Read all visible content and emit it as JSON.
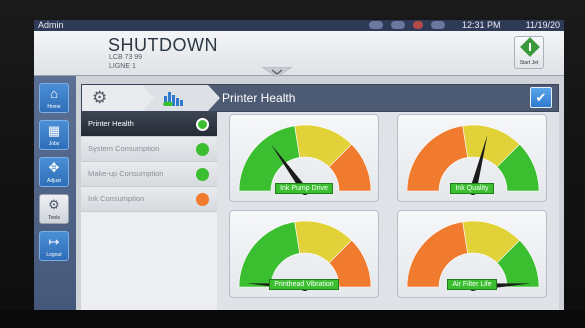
{
  "status_bar": {
    "user": "Admin",
    "time": "12:31 PM",
    "date": "11/19/20"
  },
  "header": {
    "state": "SHUTDOWN",
    "line1": "LCB 73 99",
    "line2": "LIGNE 1",
    "start_jet_label": "Start Jet"
  },
  "sidebar": {
    "items": [
      {
        "label": "Home",
        "icon": "home-icon"
      },
      {
        "label": "Jobs",
        "icon": "jobs-icon"
      },
      {
        "label": "Adjust",
        "icon": "adjust-icon"
      },
      {
        "label": "Tools",
        "icon": "gear-icon"
      },
      {
        "label": "Logout",
        "icon": "logout-icon"
      }
    ]
  },
  "breadcrumb": {
    "title": "Printer Health"
  },
  "menu": {
    "items": [
      {
        "label": "Printer Health",
        "status_color": "#3bbf30"
      },
      {
        "label": "System Consumption",
        "status_color": "#3bbf30"
      },
      {
        "label": "Make-up Consumption",
        "status_color": "#3bbf30"
      },
      {
        "label": "Ink Consumption",
        "status_color": "#f07a2e"
      }
    ]
  },
  "gauges": [
    {
      "label": "Ink Pump Drive",
      "zone_order": "green-yellow-orange",
      "level": 0.3
    },
    {
      "label": "Ink Quality",
      "zone_order": "orange-yellow-green",
      "level": 0.58
    },
    {
      "label": "Printhead Vibration",
      "zone_order": "green-yellow-orange",
      "level": 0.02
    },
    {
      "label": "Air Filter Life",
      "zone_order": "orange-yellow-green",
      "level": 0.98
    }
  ],
  "colors": {
    "green": "#3bbf30",
    "yellow": "#e2d23a",
    "orange": "#f07a2e",
    "accent_blue": "#2f7acc",
    "status_bar": "#2f3a57"
  }
}
